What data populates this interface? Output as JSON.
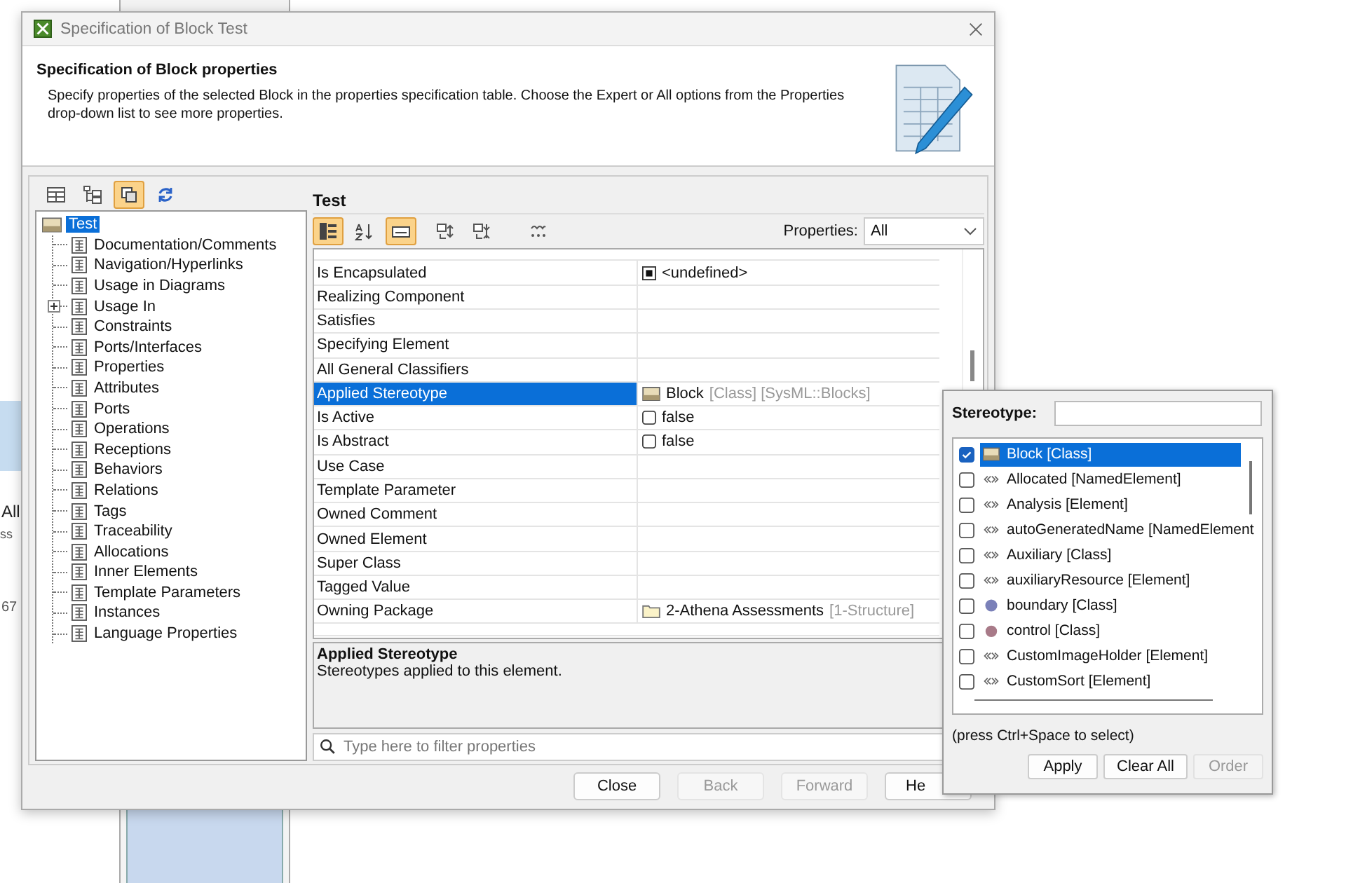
{
  "background": {
    "fragments": [
      "All",
      "ss",
      "67"
    ]
  },
  "window": {
    "title": "Specification of Block Test"
  },
  "header": {
    "title": "Specification of Block properties",
    "description": "Specify properties of the selected Block in the properties specification table. Choose the Expert or All options from the Properties drop-down list to see more properties."
  },
  "left_toolbar": [
    {
      "kind": "table",
      "selected": false
    },
    {
      "kind": "tree",
      "selected": false
    },
    {
      "kind": "copy",
      "selected": true
    },
    {
      "kind": "refresh",
      "selected": false
    }
  ],
  "tree": {
    "label": "Test",
    "selected": true,
    "children": [
      {
        "label": "Documentation/Comments",
        "expandable": false
      },
      {
        "label": "Navigation/Hyperlinks",
        "expandable": false
      },
      {
        "label": "Usage in Diagrams",
        "expandable": false
      },
      {
        "label": "Usage In",
        "expandable": true
      },
      {
        "label": "Constraints",
        "expandable": false
      },
      {
        "label": "Ports/Interfaces",
        "expandable": false
      },
      {
        "label": "Properties",
        "expandable": false
      },
      {
        "label": "Attributes",
        "expandable": false
      },
      {
        "label": "Ports",
        "expandable": false
      },
      {
        "label": "Operations",
        "expandable": false
      },
      {
        "label": "Receptions",
        "expandable": false
      },
      {
        "label": "Behaviors",
        "expandable": false
      },
      {
        "label": "Relations",
        "expandable": false
      },
      {
        "label": "Tags",
        "expandable": false
      },
      {
        "label": "Traceability",
        "expandable": false
      },
      {
        "label": "Allocations",
        "expandable": false
      },
      {
        "label": "Inner Elements",
        "expandable": false
      },
      {
        "label": "Template Parameters",
        "expandable": false
      },
      {
        "label": "Instances",
        "expandable": false
      },
      {
        "label": "Language Properties",
        "expandable": false
      }
    ]
  },
  "panel": {
    "title": "Test",
    "toolbar": [
      {
        "kind": "categorized",
        "selected": true
      },
      {
        "kind": "sort",
        "selected": false
      },
      {
        "kind": "description",
        "selected": true
      },
      {
        "kind": "expand",
        "selected": false
      },
      {
        "kind": "collapse",
        "selected": false
      },
      {
        "kind": "abc",
        "selected": false
      }
    ],
    "properties_label": "Properties:",
    "properties_value": "All"
  },
  "table": {
    "rows": [
      {
        "name": "Is Encapsulated",
        "kind": "tristate",
        "value": "<undefined>",
        "selected": false
      },
      {
        "name": "Realizing Component",
        "kind": "empty",
        "selected": false
      },
      {
        "name": "Satisfies",
        "kind": "empty",
        "selected": false
      },
      {
        "name": "Specifying Element",
        "kind": "empty",
        "selected": false
      },
      {
        "name": "All General Classifiers",
        "kind": "empty",
        "selected": false
      },
      {
        "name": "Applied Stereotype",
        "kind": "stereotype",
        "value": "Block",
        "note": "[Class] [SysML::Blocks]",
        "selected": true
      },
      {
        "name": "Is Active",
        "kind": "checkbox",
        "value": "false",
        "checked": false,
        "selected": false
      },
      {
        "name": "Is Abstract",
        "kind": "checkbox",
        "value": "false",
        "checked": false,
        "selected": false
      },
      {
        "name": "Use Case",
        "kind": "empty",
        "selected": false
      },
      {
        "name": "Template Parameter",
        "kind": "empty",
        "selected": false
      },
      {
        "name": "Owned Comment",
        "kind": "empty",
        "selected": false
      },
      {
        "name": "Owned Element",
        "kind": "empty",
        "selected": false
      },
      {
        "name": "Super Class",
        "kind": "empty",
        "selected": false
      },
      {
        "name": "Tagged Value",
        "kind": "empty",
        "selected": false
      },
      {
        "name": "Owning Package",
        "kind": "package",
        "value": "2-Athena Assessments",
        "note": "[1-Structure]",
        "selected": false
      }
    ]
  },
  "description": {
    "title": "Applied Stereotype",
    "text": "Stereotypes applied to this element."
  },
  "filter": {
    "placeholder": "Type here to filter properties"
  },
  "buttons": [
    {
      "label": "Close",
      "disabled": false
    },
    {
      "label": "Back",
      "disabled": true
    },
    {
      "label": "Forward",
      "disabled": true
    },
    {
      "label": "He",
      "disabled": false
    }
  ],
  "popup": {
    "label": "Stereotype:",
    "items": [
      {
        "label": "Block [Class]",
        "kind": "block",
        "checked": true,
        "selected": true
      },
      {
        "label": "Allocated [NamedElement]",
        "kind": "stereotype",
        "checked": false,
        "selected": false
      },
      {
        "label": "Analysis [Element]",
        "kind": "stereotype",
        "checked": false,
        "selected": false
      },
      {
        "label": "autoGeneratedName [NamedElement",
        "kind": "stereotype",
        "checked": false,
        "selected": false
      },
      {
        "label": "Auxiliary [Class]",
        "kind": "stereotype",
        "checked": false,
        "selected": false
      },
      {
        "label": "auxiliaryResource [Element]",
        "kind": "stereotype",
        "checked": false,
        "selected": false
      },
      {
        "label": "boundary [Class]",
        "kind": "boundary",
        "checked": false,
        "selected": false
      },
      {
        "label": "control [Class]",
        "kind": "control",
        "checked": false,
        "selected": false
      },
      {
        "label": "CustomImageHolder [Element]",
        "kind": "stereotype",
        "checked": false,
        "selected": false
      },
      {
        "label": "CustomSort [Element]",
        "kind": "stereotype",
        "checked": false,
        "selected": false
      }
    ],
    "hint": "(press Ctrl+Space to select)",
    "buttons": [
      {
        "label": "Apply",
        "disabled": false
      },
      {
        "label": "Clear All",
        "disabled": false
      },
      {
        "label": "Order",
        "disabled": true
      }
    ]
  }
}
